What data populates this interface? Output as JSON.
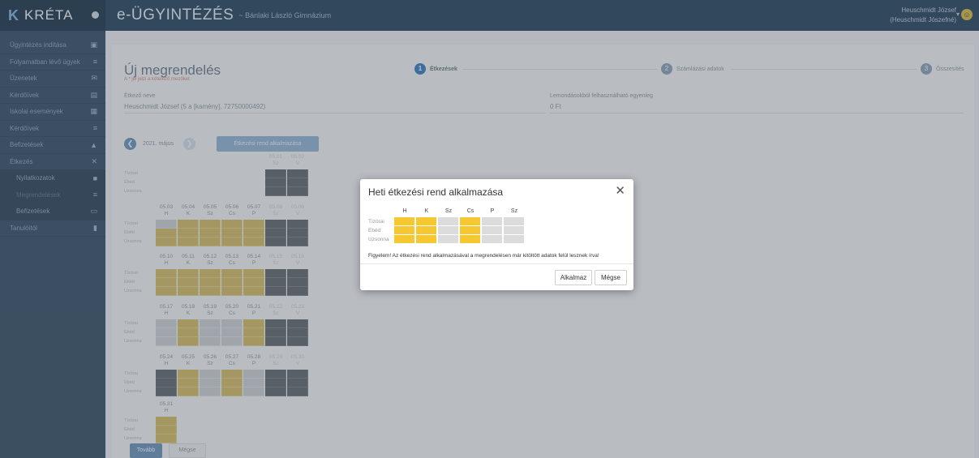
{
  "topbar": {
    "brand_logo": "K",
    "brand_name": "KRÉTA",
    "app_title": "e-ÜGYINTÉZÉS",
    "app_subtitle": "~ Bánlaki László Gimnázium",
    "user_name": "Heuschmidt József",
    "user_role": "(Heuschmidt Jószefné)"
  },
  "sidebar": {
    "items": [
      {
        "label": "Ügyintézés indítása",
        "icon": "▣"
      },
      {
        "label": "Folyamatban lévő ügyek",
        "icon": "≡"
      },
      {
        "label": "Üzenetek",
        "icon": "✉"
      },
      {
        "label": "Kérdőívek",
        "icon": "▤"
      },
      {
        "label": "Iskolai események",
        "icon": "▦"
      },
      {
        "label": "Kérdőívek",
        "icon": "≡"
      },
      {
        "label": "Befizetések",
        "icon": "▲"
      },
      {
        "label": "Étkezés",
        "icon": "✕"
      },
      {
        "label": "Nyilatkozatok",
        "icon": "■"
      },
      {
        "label": "Megrendelések",
        "icon": "≡"
      },
      {
        "label": "Befizetések",
        "icon": "▭"
      },
      {
        "label": "Tanulóitól",
        "icon": "▮"
      }
    ]
  },
  "page": {
    "title": "Új megrendelés",
    "note": "A * jel jelzi a kötelező mezőket",
    "steps": [
      {
        "num": "1",
        "label": "Étkezések"
      },
      {
        "num": "2",
        "label": "Számlázási adatok"
      },
      {
        "num": "3",
        "label": "Összesítés"
      }
    ],
    "eater_label": "Étkező neve",
    "eater_value": "Heuschmidt József (5 a [kamény], 72750000492)",
    "balance_label": "Lemondásokból felhasználható egyenleg",
    "balance_value": "0 Ft",
    "month": "2021. május",
    "prev_icon": "❮",
    "next_icon": "❯",
    "apply_rule_button": "Étkezési rend alkalmazása",
    "row_labels": [
      "Tízórai",
      "Ebéd",
      "Uzsonna"
    ],
    "weeks": [
      {
        "headers": [
          [
            "",
            ""
          ],
          [
            "",
            ""
          ],
          [
            "",
            ""
          ],
          [
            "",
            ""
          ],
          [
            "",
            ""
          ],
          [
            "05.01",
            "Sz"
          ],
          [
            "05.02",
            "V"
          ]
        ],
        "cols": [
          null,
          null,
          null,
          null,
          null,
          "ddd",
          "ddd"
        ]
      },
      {
        "headers": [
          [
            "05.03",
            "H"
          ],
          [
            "05.04",
            "K"
          ],
          [
            "05.05",
            "Sz"
          ],
          [
            "05.06",
            "Cs"
          ],
          [
            "05.07",
            "P"
          ],
          [
            "05.08",
            "Sz"
          ],
          [
            "05.09",
            "V"
          ]
        ],
        "cols": [
          "gyy",
          "yyy",
          "yyy",
          "yyy",
          "yyy",
          "ddd",
          "ddd"
        ]
      },
      {
        "headers": [
          [
            "05.10",
            "H"
          ],
          [
            "05.11",
            "K"
          ],
          [
            "05.12",
            "Sz"
          ],
          [
            "05.13",
            "Cs"
          ],
          [
            "05.14",
            "P"
          ],
          [
            "05.15",
            "Sz"
          ],
          [
            "05.16",
            "V"
          ]
        ],
        "cols": [
          "yyy",
          "yyy",
          "yyy",
          "yyy",
          "yyy",
          "ddd",
          "ddd"
        ]
      },
      {
        "headers": [
          [
            "05.17",
            "H"
          ],
          [
            "05.18",
            "K"
          ],
          [
            "05.19",
            "Sz"
          ],
          [
            "05.20",
            "Cs"
          ],
          [
            "05.21",
            "P"
          ],
          [
            "05.22",
            "Sz"
          ],
          [
            "05.23",
            "V"
          ]
        ],
        "cols": [
          "ggg",
          "yyy",
          "ggg",
          "ggg",
          "yyy",
          "ddd",
          "ddd"
        ]
      },
      {
        "headers": [
          [
            "05.24",
            "H"
          ],
          [
            "05.25",
            "K"
          ],
          [
            "05.26",
            "Sz"
          ],
          [
            "05.27",
            "Cs"
          ],
          [
            "05.28",
            "P"
          ],
          [
            "05.29",
            "Sz"
          ],
          [
            "05.30",
            "V"
          ]
        ],
        "cols": [
          "ddd",
          "yyy",
          "ggg",
          "yyy",
          "ggg",
          "ddd",
          "ddd"
        ]
      },
      {
        "headers": [
          [
            "05.31",
            "H"
          ]
        ],
        "cols": [
          "yyy"
        ]
      }
    ],
    "next_button": "Tovább",
    "cancel_button": "Mégse"
  },
  "modal": {
    "title": "Heti étkezési rend alkalmazása",
    "close_icon": "✕",
    "day_headers": [
      "H",
      "K",
      "Sz",
      "Cs",
      "P",
      "Sz"
    ],
    "row_labels": [
      "Tízórai",
      "Ebéd",
      "Uzsonna"
    ],
    "grid": [
      [
        "y",
        "y",
        "g",
        "y",
        "g",
        "g"
      ],
      [
        "y",
        "y",
        "g",
        "y",
        "g",
        "g"
      ],
      [
        "y",
        "y",
        "g",
        "y",
        "g",
        "g"
      ]
    ],
    "warning": "Figyelem! Az étkezési rend alkalmazásával a megrendelésen már kitöltött adatok felül lesznek írva!",
    "apply_button": "Alkalmaz",
    "cancel_button": "Mégse"
  },
  "colors": {
    "meal_selected": "#f5c731",
    "meal_unselected": "#dcdcdc",
    "primary": "#3f7fbf"
  }
}
